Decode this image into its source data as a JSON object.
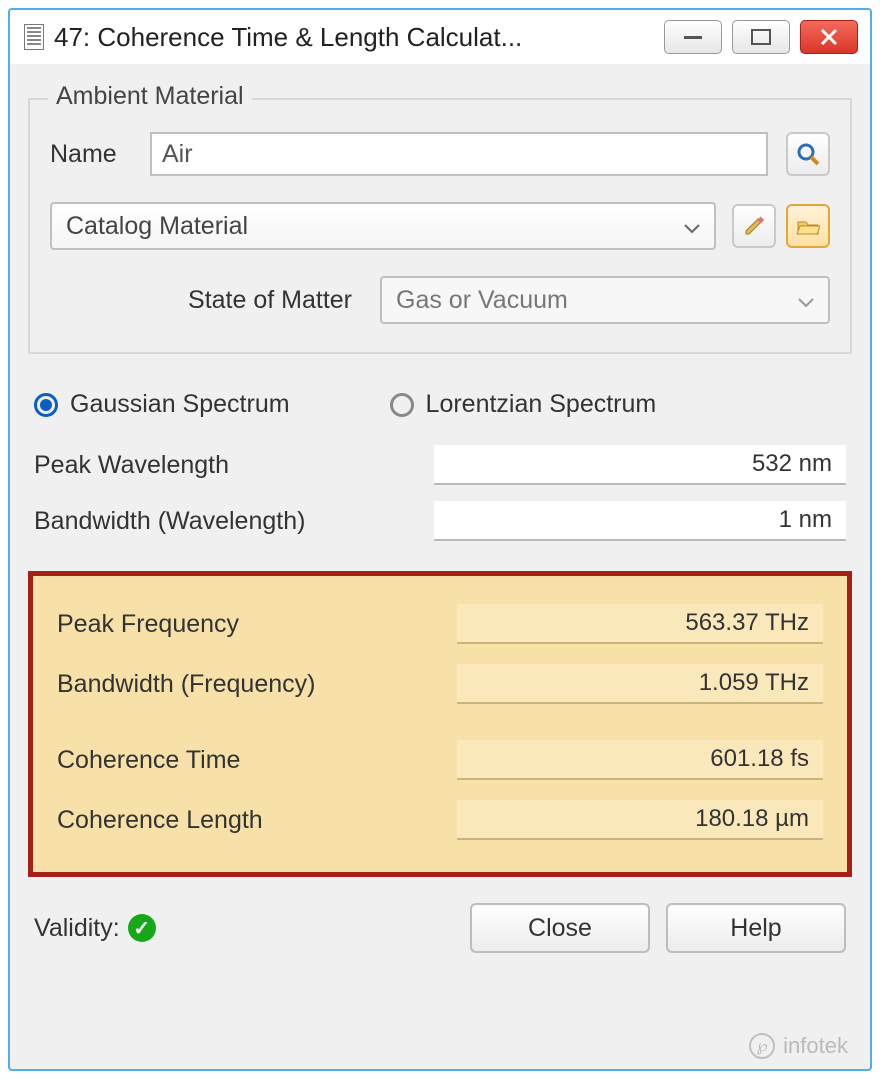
{
  "window": {
    "title": "47: Coherence Time & Length Calculat..."
  },
  "ambient": {
    "legend": "Ambient Material",
    "name_label": "Name",
    "name_value": "Air",
    "catalog_label": "Catalog Material",
    "state_label": "State of Matter",
    "state_value": "Gas or Vacuum"
  },
  "spectrum": {
    "gaussian_label": "Gaussian Spectrum",
    "lorentzian_label": "Lorentzian Spectrum",
    "selected": "gaussian"
  },
  "inputs": {
    "peak_wavelength_label": "Peak Wavelength",
    "peak_wavelength_value": "532 nm",
    "bandwidth_wavelength_label": "Bandwidth (Wavelength)",
    "bandwidth_wavelength_value": "1 nm"
  },
  "results": {
    "peak_frequency_label": "Peak Frequency",
    "peak_frequency_value": "563.37 THz",
    "bandwidth_frequency_label": "Bandwidth (Frequency)",
    "bandwidth_frequency_value": "1.059 THz",
    "coherence_time_label": "Coherence Time",
    "coherence_time_value": "601.18 fs",
    "coherence_length_label": "Coherence Length",
    "coherence_length_value": "180.18 µm"
  },
  "footer": {
    "validity_label": "Validity:",
    "close_label": "Close",
    "help_label": "Help"
  },
  "watermark": "infotek"
}
